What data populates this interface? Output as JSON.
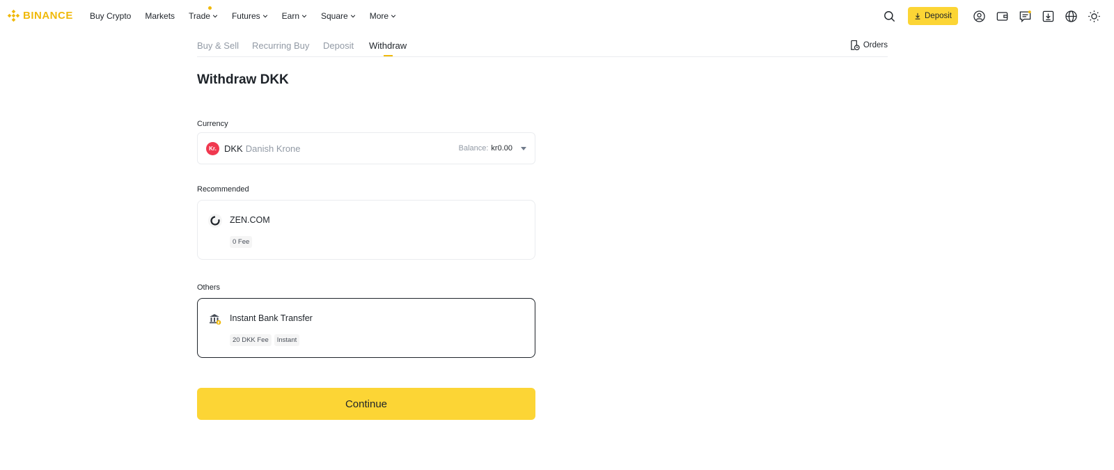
{
  "nav": {
    "logo": "BINANCE",
    "items": [
      {
        "label": "Buy Crypto",
        "dropdown": false
      },
      {
        "label": "Markets",
        "dropdown": false
      },
      {
        "label": "Trade",
        "dropdown": true
      },
      {
        "label": "Futures",
        "dropdown": true
      },
      {
        "label": "Earn",
        "dropdown": true
      },
      {
        "label": "Square",
        "dropdown": true
      },
      {
        "label": "More",
        "dropdown": true
      }
    ],
    "deposit_label": "Deposit",
    "right_icons": [
      "search-icon",
      "user-icon",
      "wallet-icon",
      "messages-icon",
      "download-icon",
      "globe-icon",
      "theme-icon"
    ]
  },
  "tabs": {
    "items": [
      "Buy & Sell",
      "Recurring Buy",
      "Deposit",
      "Withdraw"
    ],
    "active": "Withdraw",
    "orders_label": "Orders"
  },
  "page": {
    "title": "Withdraw DKK",
    "currency_label": "Currency",
    "currency": {
      "icon_text": "Kr.",
      "code": "DKK",
      "name": "Danish Krone",
      "balance_label": "Balance:",
      "balance_value": "kr0.00"
    },
    "recommended_label": "Recommended",
    "recommended": {
      "name": "ZEN.COM",
      "tags": [
        "0 Fee"
      ]
    },
    "others_label": "Others",
    "others": {
      "name": "Instant Bank Transfer",
      "tags": [
        "20 DKK Fee",
        "Instant"
      ]
    },
    "continue_label": "Continue"
  },
  "colors": {
    "brand": "#f0b90b",
    "button": "#fcd535",
    "muted": "#929aa5",
    "text": "#1e2329"
  }
}
